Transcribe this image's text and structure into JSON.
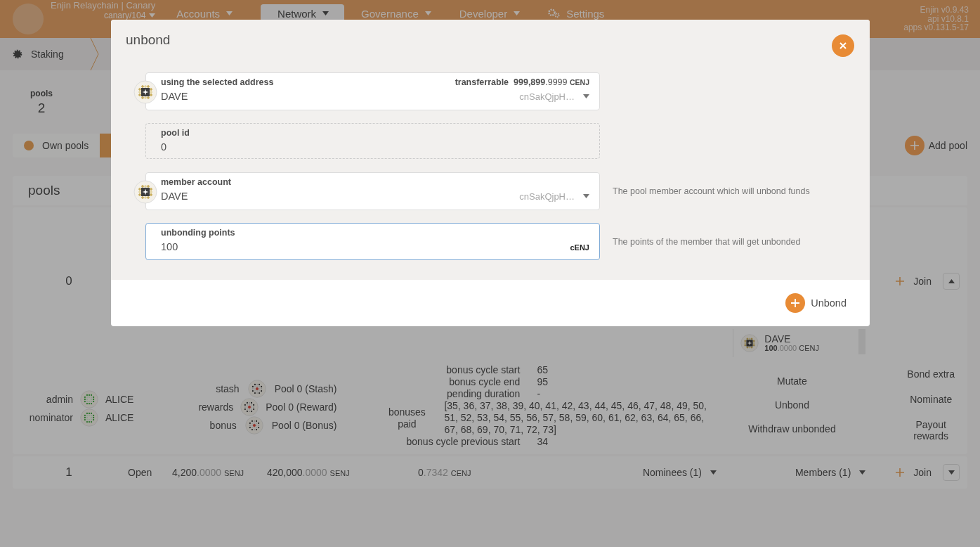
{
  "header": {
    "chain_name": "Enjin Relaychain | Canary",
    "chain_version": "canary/104",
    "menu": [
      {
        "label": "Accounts",
        "kind": "dropdown",
        "selected": false
      },
      {
        "label": "Network",
        "kind": "dropdown",
        "selected": true
      },
      {
        "label": "Governance",
        "kind": "dropdown",
        "selected": false
      },
      {
        "label": "Developer",
        "kind": "dropdown",
        "selected": false
      },
      {
        "label": "Settings",
        "kind": "settings",
        "selected": false
      }
    ],
    "versions": [
      "Enjin v0.9.43",
      "api v10.8.1",
      "apps v0.131.5-17"
    ]
  },
  "breadcrumb": {
    "label": "Staking"
  },
  "summary": {
    "label": "pools",
    "value": "2"
  },
  "tabs": [
    {
      "label": "Own pools",
      "selected": false
    },
    {
      "selected": true
    }
  ],
  "add_pool": "Add pool",
  "pools": {
    "title": "pools",
    "rows": [
      {
        "id": "0",
        "expanded": true,
        "join": "Join",
        "members": [
          {
            "name": "DAVE",
            "balance": {
              "int": "100",
              "dec": ".0000",
              "unit": "CENJ"
            }
          }
        ],
        "roles": [
          {
            "label": "admin",
            "name": "ALICE"
          },
          {
            "label": "nominator",
            "name": "ALICE"
          }
        ],
        "accounts": [
          {
            "label": "stash",
            "name": "Pool 0 (Stash)"
          },
          {
            "label": "rewards",
            "name": "Pool 0 (Reward)"
          },
          {
            "label": "bonus",
            "name": "Pool 0 (Bonus)"
          }
        ],
        "bonus": [
          {
            "kind": "value",
            "label": "bonus cycle start",
            "value": "65"
          },
          {
            "kind": "value",
            "label": "bonus cycle end",
            "value": "95"
          },
          {
            "kind": "value",
            "label": "pending duration",
            "value": "-"
          },
          {
            "kind": "list",
            "label": "bonuses paid",
            "value": "[35, 36, 37, 38, 39, 40, 41, 42, 43, 44, 45, 46, 47, 48, 49, 50, 51, 52, 53, 54, 55, 56, 57, 58, 59, 60, 61, 62, 63, 64, 65, 66, 67, 68, 69, 70, 71, 72, 73]"
          },
          {
            "kind": "value",
            "label": "bonus cycle previous start",
            "value": "34"
          }
        ],
        "actions": [
          "Mutate",
          "Unbond",
          "Withdraw unbonded"
        ],
        "owner_actions": [
          "Bond extra",
          "Nominate",
          "Payout rewards"
        ]
      },
      {
        "id": "1",
        "expanded": false,
        "join": "Join",
        "state": "Open",
        "bonded": {
          "int": "4,200",
          "dec": ".0000",
          "unit": "SENJ"
        },
        "points": {
          "int": "420,000",
          "dec": ".0000",
          "unit": "SENJ"
        },
        "claimable": {
          "int": "0",
          "dec": ".7342",
          "unit": "CENJ"
        },
        "nominees": "Nominees (1)",
        "members_label": "Members (1)"
      }
    ]
  },
  "modal": {
    "title": "unbond",
    "submit": "Unbond",
    "fields": [
      {
        "kind": "account",
        "label": "using the selected address",
        "value": "DAVE",
        "address": "cnSakQjpH…",
        "extra_label": "transferrable",
        "extra": {
          "int": "999,899",
          "dec": ".9999",
          "unit": "CENJ"
        }
      },
      {
        "kind": "static",
        "label": "pool id",
        "value": "0"
      },
      {
        "kind": "account",
        "label": "member account",
        "value": "DAVE",
        "address": "cnSakQjpH…",
        "help": "The pool member account which will unbond funds"
      },
      {
        "kind": "amount",
        "label": "unbonding points",
        "value": "100",
        "unit": "cENJ",
        "focused": true,
        "help": "The points of the member that will get unbonded"
      }
    ]
  }
}
